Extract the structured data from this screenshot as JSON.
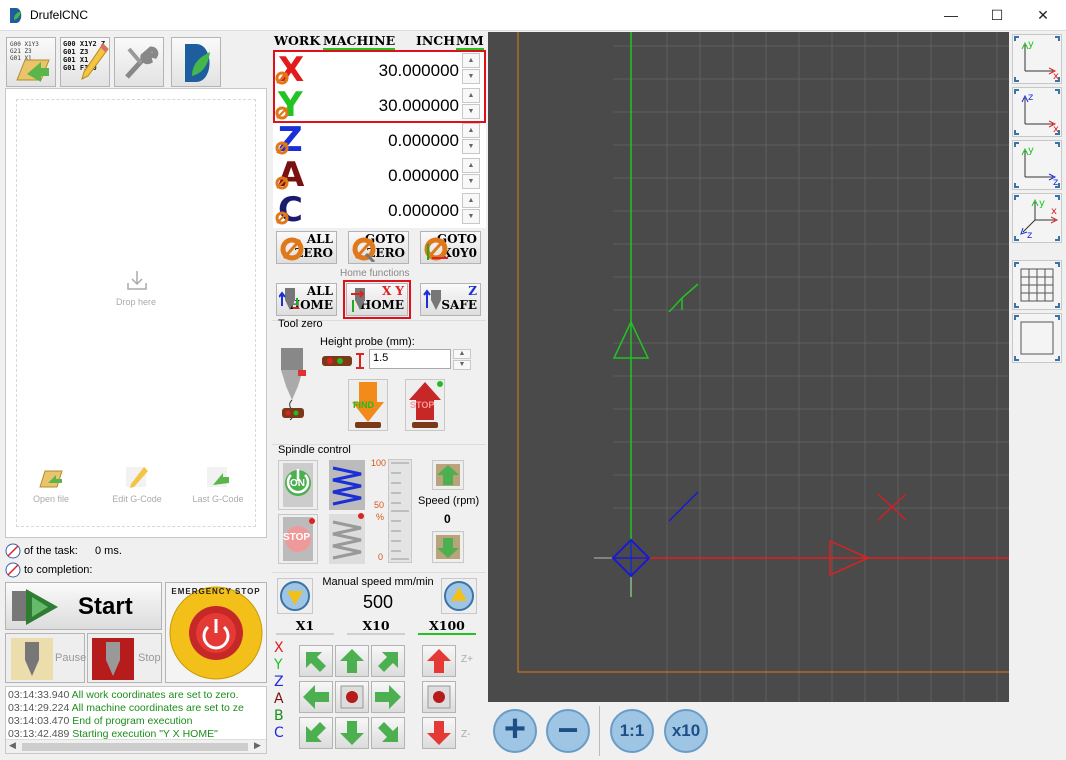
{
  "window": {
    "title": "DrufelCNC",
    "minimize_icon": "minimize-icon",
    "maximize_icon": "maximize-icon",
    "close_icon": "close-icon"
  },
  "toolbar": {
    "items": [
      "open-file-icon",
      "edit-gcode-icon",
      "settings-wrench-icon",
      "drufel-logo-icon"
    ]
  },
  "toolbar_icon_text": {
    "gcode_lines": [
      "G00 X1Y2 Z",
      "G01 Z3",
      "G01 X1",
      "G01 F300"
    ]
  },
  "file_panel": {
    "drop_label": "Drop here",
    "open_file": "Open file",
    "edit_gcode": "Edit G-Code",
    "last_gcode": "Last G-Code"
  },
  "task": {
    "label": "of the task:",
    "value": "0 ms.",
    "completion_label": "to completion:"
  },
  "start": {
    "label": "Start"
  },
  "pause": {
    "label": "Pause"
  },
  "stop": {
    "label": "Stop"
  },
  "emergency": {
    "label": "EMERGENCY STOP"
  },
  "log": {
    "lines": [
      {
        "time": "03:14:33.940",
        "text": "All work coordinates are set to zero."
      },
      {
        "time": "03:14:29.224",
        "text": "All machine coordinates are set to ze"
      },
      {
        "time": "03:14:03.470",
        "text": "End of program execution"
      },
      {
        "time": "03:13:42.489",
        "text": "Starting execution \"Y X HOME\""
      }
    ]
  },
  "coord_tabs": {
    "work": "WORK",
    "machine": "MACHINE",
    "inch": "INCH",
    "mm": "MM"
  },
  "axes": [
    {
      "letter": "X",
      "value": "30.000000",
      "color": "#e21b1b"
    },
    {
      "letter": "Y",
      "value": "30.000000",
      "color": "#22c322"
    },
    {
      "letter": "Z",
      "value": "0.000000",
      "color": "#1b2fd8"
    },
    {
      "letter": "A",
      "value": "0.000000",
      "color": "#7a1010"
    },
    {
      "letter": "C",
      "value": "0.000000",
      "color": "#1a1a6e"
    }
  ],
  "zero_buttons": {
    "all_zero": [
      "ALL",
      "ZERO"
    ],
    "goto_zero": [
      "GOTO",
      "ZERO"
    ],
    "goto_x0y0": [
      "GOTO",
      "X0Y0"
    ]
  },
  "home": {
    "section_label": "Home functions",
    "all_home": [
      "ALL",
      "HOME"
    ],
    "xy_home": [
      "X Y",
      "HOME"
    ],
    "z_safe": [
      "Z",
      "SAFE"
    ]
  },
  "tool_zero": {
    "section_label": "Tool zero",
    "height_probe_label": "Height probe (mm):",
    "height_probe_value": "1.5",
    "find_label": "FIND",
    "stop_label": "STOP"
  },
  "spindle": {
    "section_label": "Spindle control",
    "on_label": "ON",
    "stop_label": "STOP",
    "scale_100": "100",
    "scale_50": "50",
    "scale_pct": "%",
    "scale_0": "0",
    "speed_label": "Speed (rpm)",
    "speed_value": "0"
  },
  "manual": {
    "speed_label": "Manual speed mm/min",
    "speed_value": "500",
    "steps": [
      "X1",
      "X10",
      "X100"
    ],
    "selected_step": "X100",
    "axis_letters": [
      "X",
      "Y",
      "Z",
      "A",
      "B",
      "C"
    ],
    "z_plus": "Z+",
    "z_minus": "Z-"
  },
  "canvas": {
    "background": "#4a4a4a",
    "grid_color": "#5c5c5c",
    "x_axis_color": "#e02020",
    "y_axis_color": "#22c322",
    "origin_color": "#1a1ad0",
    "border_color": "#e07a1a"
  },
  "view_buttons": [
    "view-xy-icon",
    "view-xz-icon",
    "view-yz-icon",
    "view-3d-icon",
    "grid-toggle-icon",
    "frame-toggle-icon"
  ],
  "zoom": {
    "plus": "+",
    "minus": "−",
    "fit": "1:1",
    "x10": "x10"
  },
  "colors": {
    "highlight_red": "#e0101a",
    "accent_green": "#22c322"
  }
}
